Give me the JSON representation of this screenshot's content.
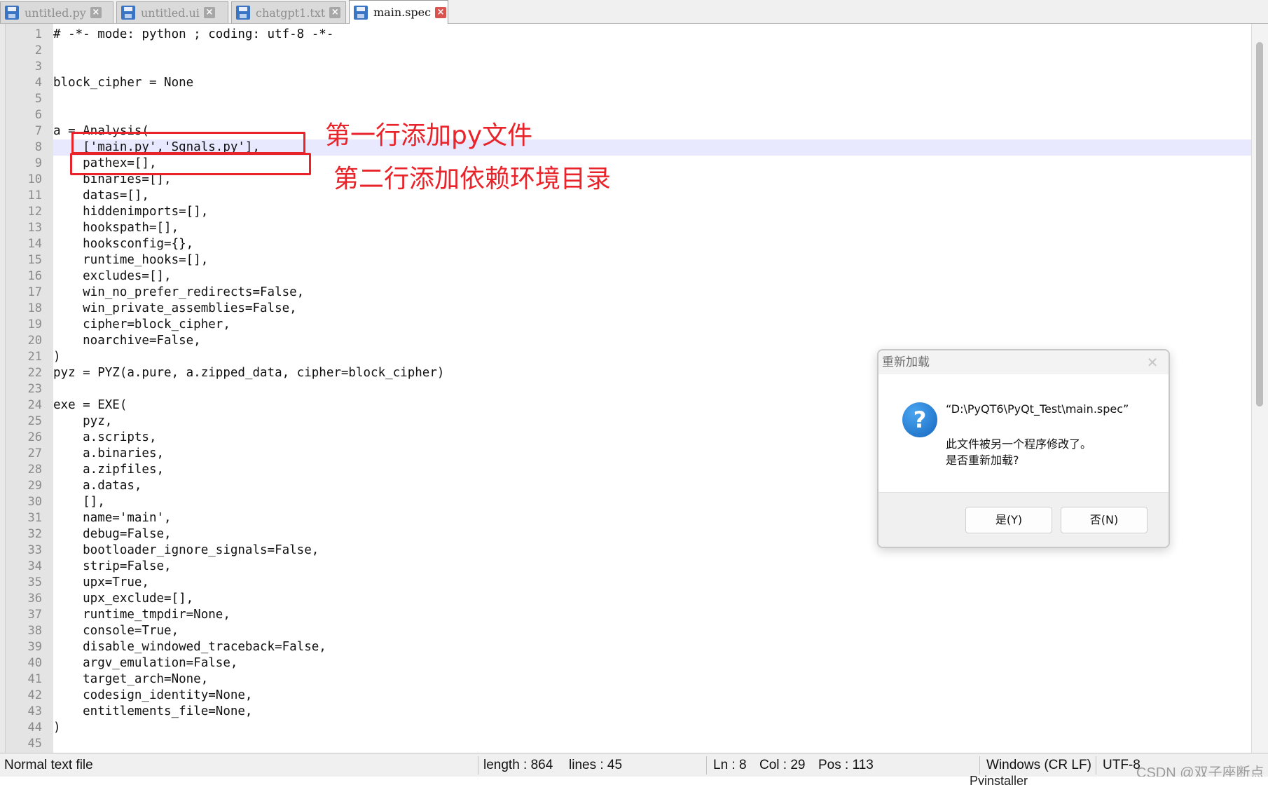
{
  "tabs": [
    {
      "label": "untitled.py",
      "active": false
    },
    {
      "label": "untitled.ui",
      "active": false
    },
    {
      "label": "chatgpt1.txt",
      "active": false
    },
    {
      "label": "main.spec",
      "active": true
    }
  ],
  "editor": {
    "current_line": 8,
    "lines": [
      "# -*- mode: python ; coding: utf-8 -*-",
      "",
      "",
      "block_cipher = None",
      "",
      "",
      "a = Analysis(",
      "    ['main.py','Sgnals.py'],",
      "    pathex=[],",
      "    binaries=[],",
      "    datas=[],",
      "    hiddenimports=[],",
      "    hookspath=[],",
      "    hooksconfig={},",
      "    runtime_hooks=[],",
      "    excludes=[],",
      "    win_no_prefer_redirects=False,",
      "    win_private_assemblies=False,",
      "    cipher=block_cipher,",
      "    noarchive=False,",
      ")",
      "pyz = PYZ(a.pure, a.zipped_data, cipher=block_cipher)",
      "",
      "exe = EXE(",
      "    pyz,",
      "    a.scripts,",
      "    a.binaries,",
      "    a.zipfiles,",
      "    a.datas,",
      "    [],",
      "    name='main',",
      "    debug=False,",
      "    bootloader_ignore_signals=False,",
      "    strip=False,",
      "    upx=True,",
      "    upx_exclude=[],",
      "    runtime_tmpdir=None,",
      "    console=True,",
      "    disable_windowed_traceback=False,",
      "    argv_emulation=False,",
      "    target_arch=None,",
      "    codesign_identity=None,",
      "    entitlements_file=None,",
      ")",
      ""
    ]
  },
  "annotations": {
    "note1": "第一行添加py文件",
    "note2": "第二行添加依赖环境目录",
    "color": "#e8232a"
  },
  "dialog": {
    "title": "重新加载",
    "path": "“D:\\PyQT6\\PyQt_Test\\main.spec”",
    "message_line1": "此文件被另一个程序修改了。",
    "message_line2": "是否重新加载?",
    "yes_label": "是(Y)",
    "no_label": "否(N)",
    "icon": "question-icon"
  },
  "statusbar": {
    "file_type": "Normal text file",
    "length": "length : 864",
    "lines": "lines : 45",
    "ln": "Ln : 8",
    "col": "Col : 29",
    "pos": "Pos : 113",
    "eol": "Windows (CR LF)",
    "encoding": "UTF-8"
  },
  "watermark": "CSDN @双子座断点",
  "below_text": "Pyinstaller"
}
